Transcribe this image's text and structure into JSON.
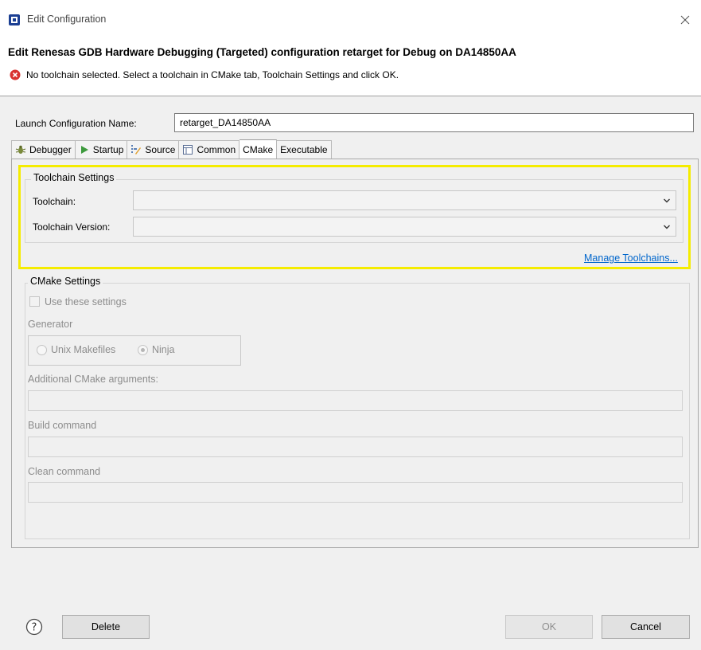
{
  "window": {
    "title": "Edit Configuration"
  },
  "header": {
    "heading": "Edit Renesas GDB Hardware Debugging (Targeted) configuration retarget for Debug on DA14850AA",
    "message": "No toolchain selected. Select a toolchain in CMake tab, Toolchain Settings and click OK."
  },
  "launch": {
    "label": "Launch Configuration Name:",
    "value": "retarget_DA14850AA"
  },
  "tabs": [
    {
      "label": "Debugger",
      "icon": "bug-icon",
      "active": false
    },
    {
      "label": "Startup",
      "icon": "play-icon",
      "active": false
    },
    {
      "label": "Source",
      "icon": "source-icon",
      "active": false
    },
    {
      "label": "Common",
      "icon": "common-icon",
      "active": false
    },
    {
      "label": "CMake",
      "icon": "",
      "active": true
    },
    {
      "label": "Executable",
      "icon": "",
      "active": false
    }
  ],
  "toolchain_settings": {
    "group_label": "Toolchain Settings",
    "toolchain_label": "Toolchain:",
    "toolchain_value": "",
    "version_label": "Toolchain Version:",
    "version_value": "",
    "manage_link": "Manage Toolchains..."
  },
  "cmake_settings": {
    "group_label": "CMake Settings",
    "use_settings_label": "Use these settings",
    "use_settings_checked": false,
    "generator_label": "Generator",
    "generator_options": [
      "Unix Makefiles",
      "Ninja"
    ],
    "generator_selected": "Ninja",
    "args_label": "Additional CMake arguments:",
    "args_value": "",
    "build_label": "Build command",
    "build_value": "",
    "clean_label": "Clean command",
    "clean_value": ""
  },
  "buttons": {
    "help": "?",
    "delete": "Delete",
    "ok": "OK",
    "cancel": "Cancel"
  },
  "colors": {
    "highlight": "#f5ec00",
    "link": "#0066cc",
    "error": "#d9322f"
  }
}
